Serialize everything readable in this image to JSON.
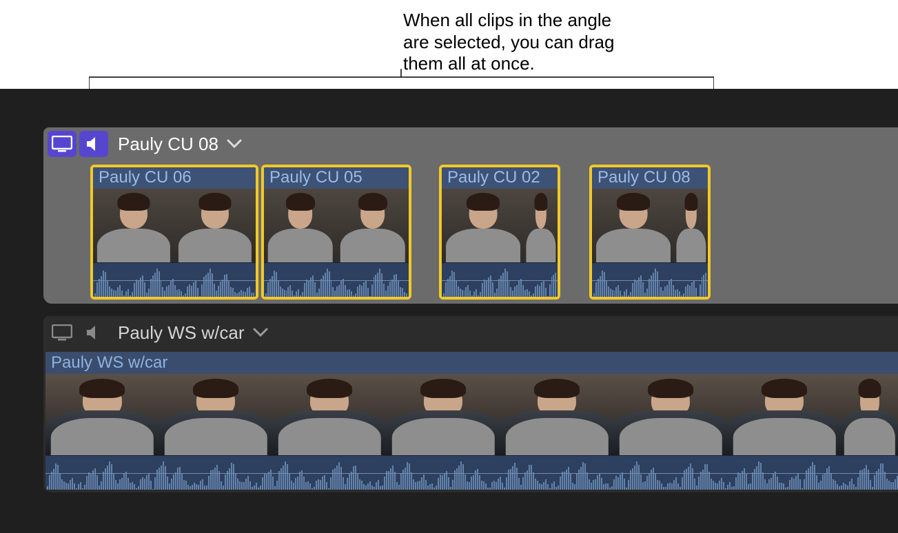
{
  "callout": {
    "line1": "When all clips in the angle",
    "line2": "are selected, you can drag",
    "line3": "them all at once."
  },
  "angle1": {
    "title": "Pauly CU 08",
    "clips": [
      {
        "label": "Pauly CU 06"
      },
      {
        "label": "Pauly CU 05"
      },
      {
        "label": "Pauly CU 02"
      },
      {
        "label": "Pauly CU 08"
      }
    ]
  },
  "angle2": {
    "title": "Pauly WS w/car",
    "clip_label": "Pauly WS w/car"
  },
  "icons": {
    "monitor": "monitor-icon",
    "speaker": "speaker-icon",
    "chevron": "chevron-down-icon"
  },
  "colors": {
    "selection": "#f2c925",
    "activeBadge": "#5646cf"
  }
}
